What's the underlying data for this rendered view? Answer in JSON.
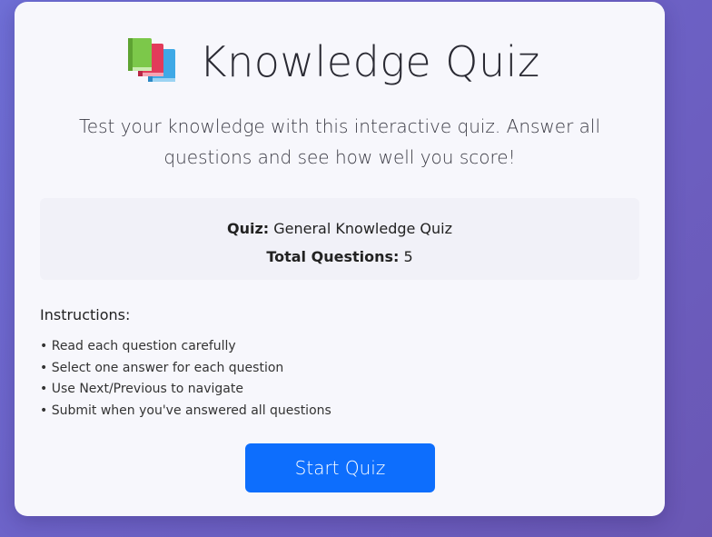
{
  "header": {
    "icon": "books-icon",
    "title": "Knowledge Quiz"
  },
  "intro": {
    "description": "Test your knowledge with this interactive quiz. Answer all questions and see how well you score!"
  },
  "quiz_info": {
    "quiz_label": "Quiz:",
    "quiz_name": "General Knowledge Quiz",
    "total_label": "Total Questions:",
    "total_value": "5"
  },
  "instructions": {
    "heading": "Instructions:",
    "items": [
      "Read each question carefully",
      "Select one answer for each question",
      "Use Next/Previous to navigate",
      "Submit when you've answered all questions"
    ]
  },
  "actions": {
    "start_label": "Start Quiz"
  },
  "colors": {
    "primary": "#0d6efd",
    "background_gradient_start": "#6f6fd6",
    "background_gradient_end": "#6a57b4",
    "card": "#f7f7fc"
  }
}
